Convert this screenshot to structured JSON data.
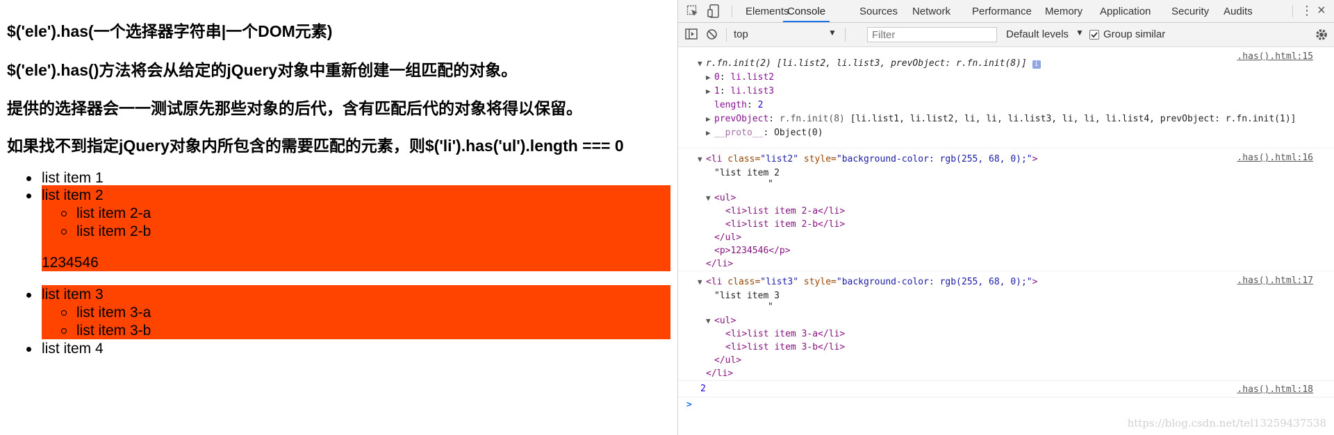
{
  "page": {
    "headings": [
      "$('ele').has(一个选择器字符串|一个DOM元素)",
      "$('ele').has()方法将会从给定的jQuery对象中重新创建一组匹配的对象。",
      "提供的选择器会一一测试原先那些对象的后代，含有匹配后代的对象将得以保留。",
      "如果找不到指定jQuery对象内所包含的需要匹配的元素，则$('li').has('ul').length === 0"
    ],
    "items": {
      "item1": "list item 1",
      "item2": "list item 2",
      "item2a": "list item 2-a",
      "item2b": "list item 2-b",
      "item2p": "1234546",
      "item3": "list item 3",
      "item3a": "list item 3-a",
      "item3b": "list item 3-b",
      "item4": "list item 4"
    },
    "highlight_color": "#ff4400"
  },
  "devtools": {
    "tabs": [
      "Elements",
      "Console",
      "Sources",
      "Network",
      "Performance",
      "Memory",
      "Application",
      "Security",
      "Audits"
    ],
    "active_tab": "Console",
    "context": "top",
    "filter_placeholder": "Filter",
    "levels": "Default levels",
    "group_similar": "Group similar",
    "entries": {
      "e1": {
        "source": ".has().html:15",
        "header_fn": "r.fn.init(2) ",
        "header_list": "[li.list2, li.list3, prevObject: r.fn.init(8)]",
        "row0_key": "0",
        "row0_val": "li.list2",
        "row1_key": "1",
        "row1_val": "li.list3",
        "length_key": "length",
        "length_val": "2",
        "prev_key": "prevObject",
        "prev_fn": "r.fn.init(8) ",
        "prev_list": "[li.list1, li.list2, li, li, li.list3, li, li, li.list4, prevObject: r.fn.init(1)]",
        "proto_key": "__proto__",
        "proto_val": "Object(0)"
      },
      "e2": {
        "source": ".has().html:16",
        "open_tag": "<li",
        "class_attr": " class=",
        "class_val": "\"list2\"",
        "style_attr": " style=",
        "style_val": "\"background-color: rgb(255, 68, 0);\"",
        "open_end": ">",
        "text1": "\"list item 2",
        "text2": "\"",
        "ul_open": "<ul>",
        "li_a": "<li>list item 2-a</li>",
        "li_b": "<li>list item 2-b</li>",
        "ul_close": "</ul>",
        "p": "<p>1234546</p>",
        "li_close": "</li>"
      },
      "e3": {
        "source": ".has().html:17",
        "open_tag": "<li",
        "class_attr": " class=",
        "class_val": "\"list3\"",
        "style_attr": " style=",
        "style_val": "\"background-color: rgb(255, 68, 0);\"",
        "open_end": ">",
        "text1": "\"list item 3",
        "text2": "\"",
        "ul_open": "<ul>",
        "li_a": "<li>list item 3-a</li>",
        "li_b": "<li>list item 3-b</li>",
        "ul_close": "</ul>",
        "li_close": "</li>"
      },
      "e4": {
        "source": ".has().html:18",
        "value": "2"
      }
    },
    "prompt": ">",
    "watermark": "https://blog.csdn.net/tel13259437538"
  }
}
